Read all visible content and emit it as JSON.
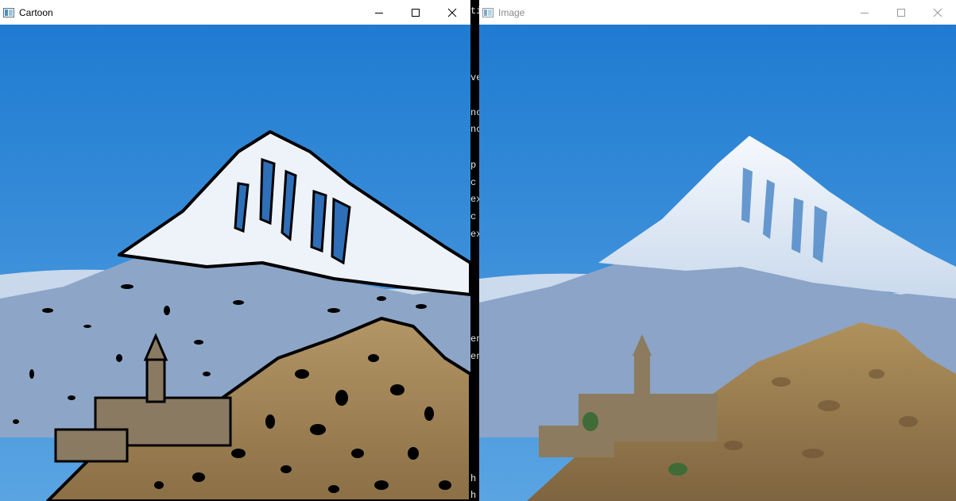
{
  "windows": [
    {
      "title": "Cartoon",
      "active": true
    },
    {
      "title": "Image",
      "active": false
    }
  ],
  "console_fragments": [
    "ti",
    "ve",
    "nc",
    "nc",
    "p",
    "c",
    "ex",
    "c",
    "ex",
    "en",
    "en",
    "h",
    "h"
  ],
  "colors": {
    "sky_top": "#1f7bd1",
    "sky_bottom": "#5aa4e2",
    "snow": "#eef3fa",
    "mountain_blue": "#8da6c8",
    "hill_brown": "#a88b5f",
    "church_stone": "#8a7a62",
    "outline": "#000000"
  },
  "icons": [
    "app-icon",
    "minimize-icon",
    "maximize-icon",
    "close-icon"
  ]
}
